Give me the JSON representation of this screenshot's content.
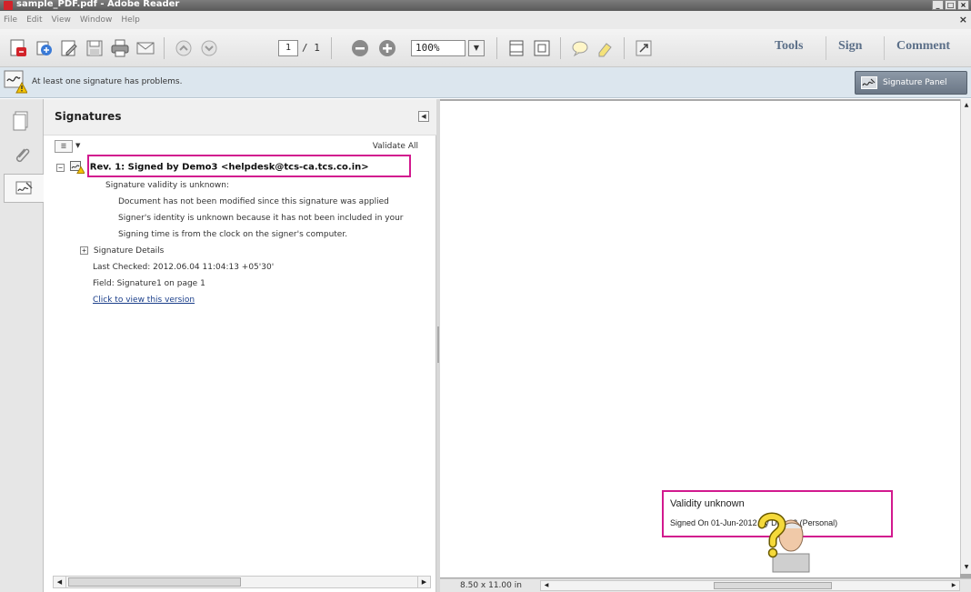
{
  "window": {
    "title": "sample_PDF.pdf - Adobe Reader",
    "controls": [
      "_",
      "□",
      "×"
    ]
  },
  "menubar": {
    "items": [
      "File",
      "Edit",
      "View",
      "Window",
      "Help"
    ],
    "close_glyph": "×"
  },
  "toolbar": {
    "page_current": "1",
    "page_total": "/ 1",
    "zoom": "100%",
    "tools_label": "Tools",
    "sign_label": "Sign",
    "comment_label": "Comment"
  },
  "message_bar": {
    "text": "At least one signature has problems.",
    "panel_button": "Signature Panel"
  },
  "signatures_panel": {
    "title": "Signatures",
    "validate_all": "Validate All",
    "revision_title": "Rev. 1: Signed by Demo3 <helpdesk@tcs-ca.tcs.co.in>",
    "validity_status": "Signature validity is unknown:",
    "details": [
      "Document has not been modified since this signature was applied",
      "Signer's identity is unknown because it has not been included in your",
      "Signing time is from the clock on the signer's computer."
    ],
    "signature_details_label": "Signature Details",
    "last_checked": "Last Checked: 2012.06.04 11:04:13 +05'30'",
    "field": "Field: Signature1 on page 1",
    "view_version_link": "Click to view this version"
  },
  "document": {
    "signature_validity": "Validity unknown",
    "signed_on": "Signed On 01-Jun-2012 By Demo3  (Personal)"
  },
  "statusbar": {
    "page_size": "8.50 x 11.00 in"
  },
  "colors": {
    "highlight": "#d2198e",
    "message_bar_bg": "#dce6ee",
    "toolbar_right_text": "#5b6f88"
  }
}
